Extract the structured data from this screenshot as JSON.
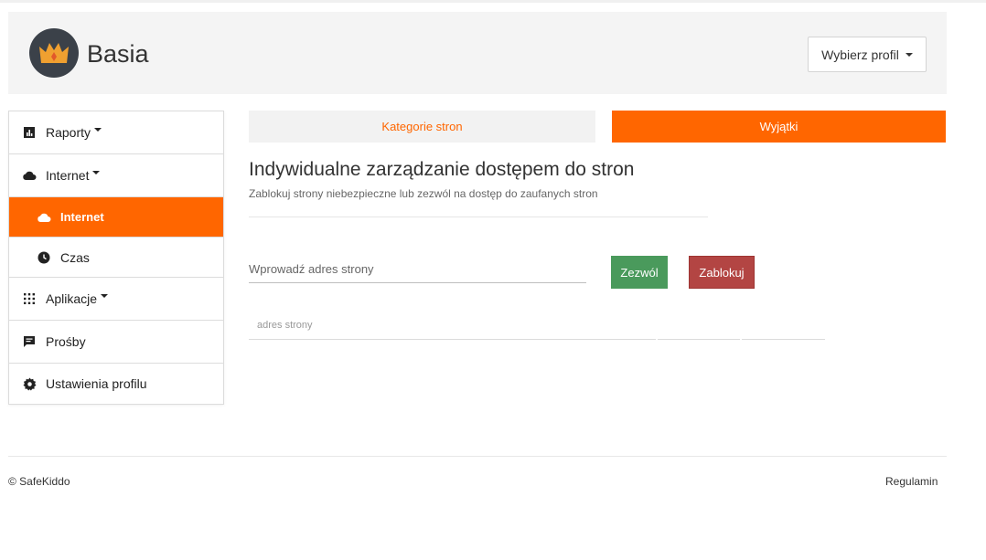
{
  "header": {
    "profile_name": "Basia",
    "profile_select_label": "Wybierz profil",
    "avatar_icon": "crown-icon"
  },
  "sidebar": {
    "items": [
      {
        "label": "Raporty",
        "icon": "bar-chart-icon"
      },
      {
        "label": "Internet",
        "icon": "cloud-icon"
      },
      {
        "label": "Internet",
        "icon": "cloud-icon",
        "active": true
      },
      {
        "label": "Czas",
        "icon": "clock-icon"
      },
      {
        "label": "Aplikacje",
        "icon": "grid-icon"
      },
      {
        "label": "Prośby",
        "icon": "message-icon"
      },
      {
        "label": "Ustawienia profilu",
        "icon": "gear-icon"
      }
    ]
  },
  "tabs": [
    {
      "label": "Kategorie stron",
      "active": false
    },
    {
      "label": "Wyjątki",
      "active": true
    }
  ],
  "main": {
    "title": "Indywidualne zarządzanie dostępem do stron",
    "subtitle": "Zablokuj strony niebezpieczne lub zezwól na dostęp do zaufanych stron",
    "url_placeholder": "Wprowadź adres strony",
    "allow_label": "Zezwól",
    "block_label": "Zablokuj",
    "table_headers": [
      "adres strony",
      "",
      ""
    ]
  },
  "footer": {
    "copyright": "© SafeKiddo",
    "terms": "Regulamin"
  },
  "colors": {
    "accent": "#ff6600",
    "allow": "#4a9a5c",
    "block": "#b34543",
    "avatar_bg": "#3b4149"
  }
}
